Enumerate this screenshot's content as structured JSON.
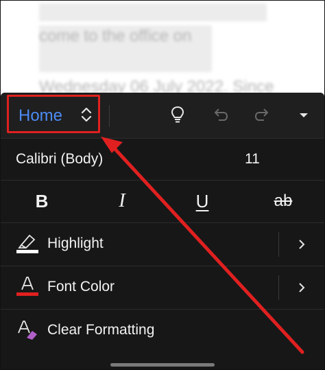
{
  "document": {
    "line1": "come to the office on",
    "line2": "Wednesday 06 July 2022. Since"
  },
  "toolbar": {
    "tab_label": "Home",
    "tab_switch_icon": "chevron-up-down-icon",
    "actions": [
      {
        "name": "tell-me-button",
        "icon": "lightbulb-icon"
      },
      {
        "name": "undo-button",
        "icon": "undo-icon"
      },
      {
        "name": "redo-button",
        "icon": "redo-icon"
      },
      {
        "name": "collapse-ribbon-button",
        "icon": "caret-down-icon"
      }
    ]
  },
  "font": {
    "name": "Calibri (Body)",
    "size": "11"
  },
  "format_buttons": {
    "bold": "B",
    "italic": "I",
    "underline": "U",
    "strikethrough": "ab"
  },
  "menu": {
    "highlight": {
      "label": "Highlight",
      "swatch_color": "#ffffff",
      "icon": "highlighter-icon"
    },
    "font_color": {
      "label": "Font Color",
      "swatch_color": "#e02020",
      "icon": "font-color-icon"
    },
    "clear_formatting": {
      "label": "Clear Formatting",
      "icon": "clear-formatting-icon"
    }
  },
  "colors": {
    "accent": "#4c8bf5",
    "annotation": "#e02020",
    "panel_bg": "#171717"
  }
}
